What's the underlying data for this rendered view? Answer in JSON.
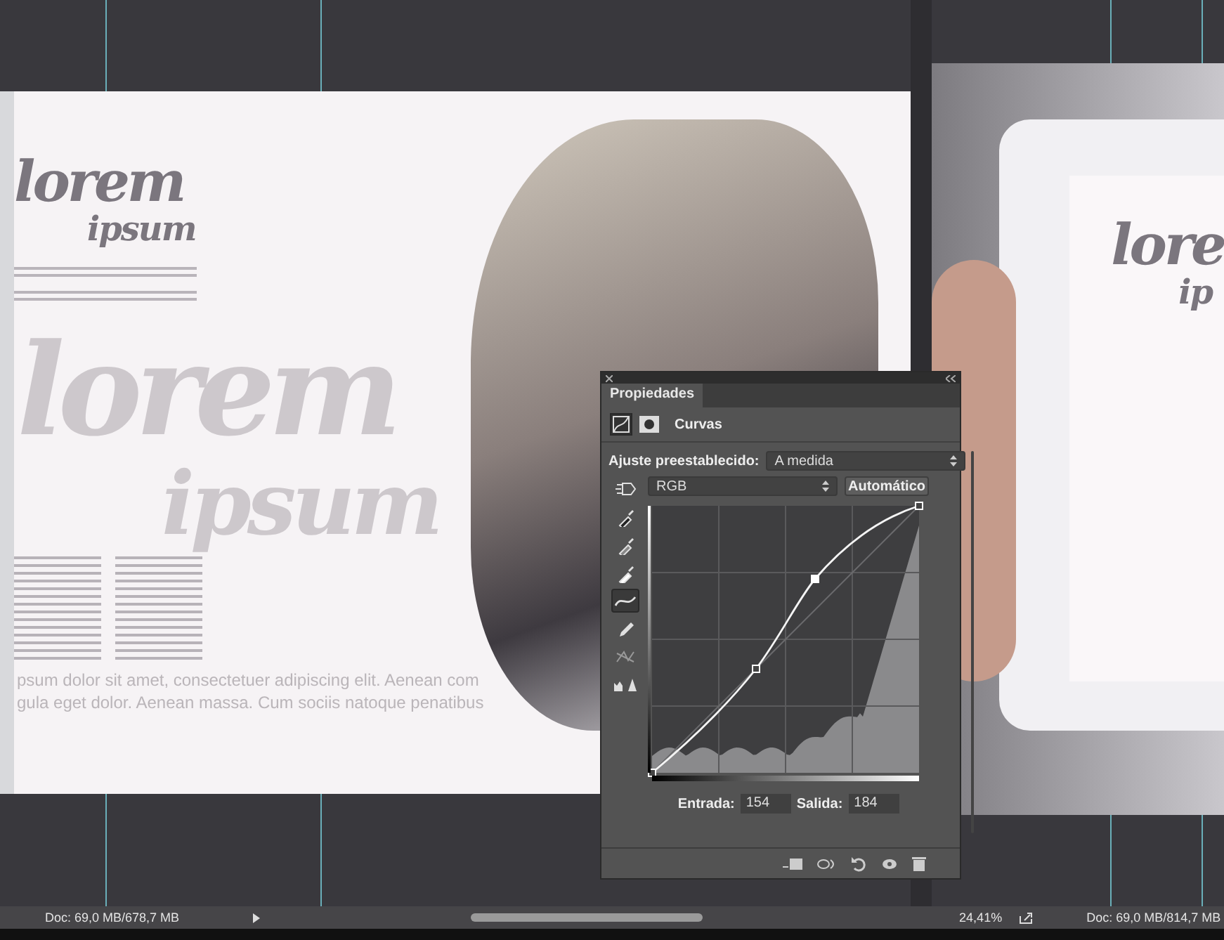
{
  "left_document": {
    "heading": "lorem",
    "subheading": "ipsum",
    "backdrop_heading": "lorem",
    "backdrop_subheading": "ipsum",
    "body_lines": [
      "psum dolor sit amet, consectetuer adipiscing elit. Aenean com",
      "gula eget dolor. Aenean massa. Cum sociis natoque penatibus"
    ]
  },
  "right_document": {
    "heading": "lore",
    "subheading": "ip"
  },
  "panel": {
    "title": "Propiedades",
    "adjustment": "Curvas",
    "adjustment_icons": [
      {
        "kind": "curves",
        "selected": true
      },
      {
        "kind": "mask",
        "selected": false
      }
    ],
    "preset_label": "Ajuste preestablecido:",
    "preset_value": "A medida",
    "channel": "RGB",
    "auto_button": "Automático",
    "tools": [
      {
        "kind": "hand",
        "selected": false
      },
      {
        "kind": "dropper-black",
        "selected": false
      },
      {
        "kind": "dropper-gray",
        "selected": false
      },
      {
        "kind": "dropper-white",
        "selected": false
      },
      {
        "kind": "curve",
        "selected": true
      },
      {
        "kind": "pencil",
        "selected": false
      },
      {
        "kind": "smooth",
        "selected": false
      },
      {
        "kind": "clipping",
        "selected": false
      }
    ],
    "input_label": "Entrada:",
    "input_value": "154",
    "output_label": "Salida:",
    "output_value": "184"
  },
  "status_left": {
    "doc": "Doc: 69,0 MB/678,7 MB"
  },
  "status_right": {
    "zoom": "24,41%",
    "doc": "Doc: 69,0 MB/814,7 MB"
  }
}
